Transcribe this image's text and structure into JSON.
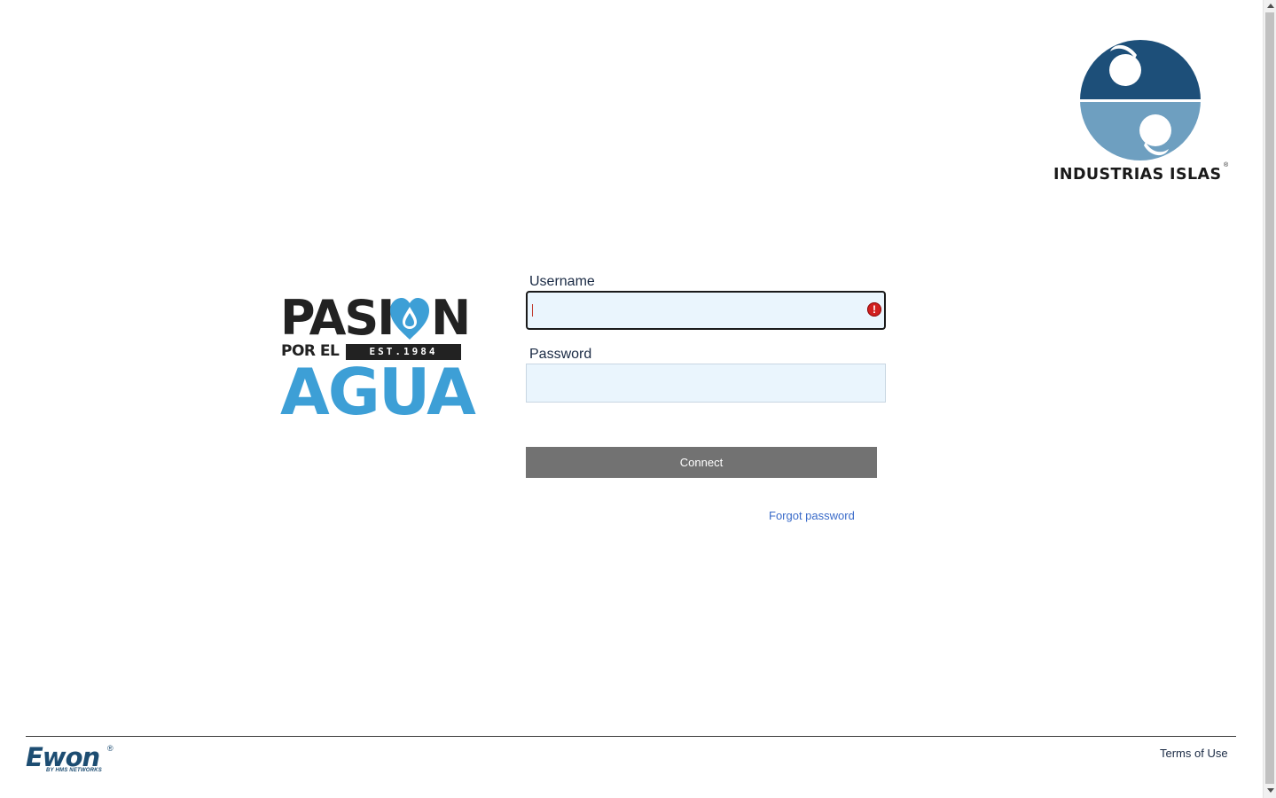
{
  "brand": {
    "name": "INDUSTRIAS ISLAS",
    "registered_mark": "®",
    "icon": "industrias-islas-logo-icon"
  },
  "campaign": {
    "line1": "PASI",
    "line1_end": "N",
    "line2": "POR EL",
    "est": "EST.1984",
    "line3": "AGUA",
    "icon": "water-drop-heart-icon"
  },
  "form": {
    "username_label": "Username",
    "username_value": "",
    "password_label": "Password",
    "password_value": "",
    "error_icon": "error-exclamation-icon",
    "connect_label": "Connect",
    "forgot_label": "Forgot password"
  },
  "footer": {
    "logo_word": "Ewon",
    "logo_reg": "®",
    "logo_sub": "BY HMS NETWORKS",
    "terms_label": "Terms of Use"
  },
  "colors": {
    "brand_dark_blue": "#1d4f79",
    "brand_light_blue": "#6e9fc0",
    "agua_blue": "#3d9fd6",
    "input_bg": "#eaf5fd",
    "button_bg": "#727272",
    "link": "#3a6bc9",
    "error": "#d11f1f"
  }
}
